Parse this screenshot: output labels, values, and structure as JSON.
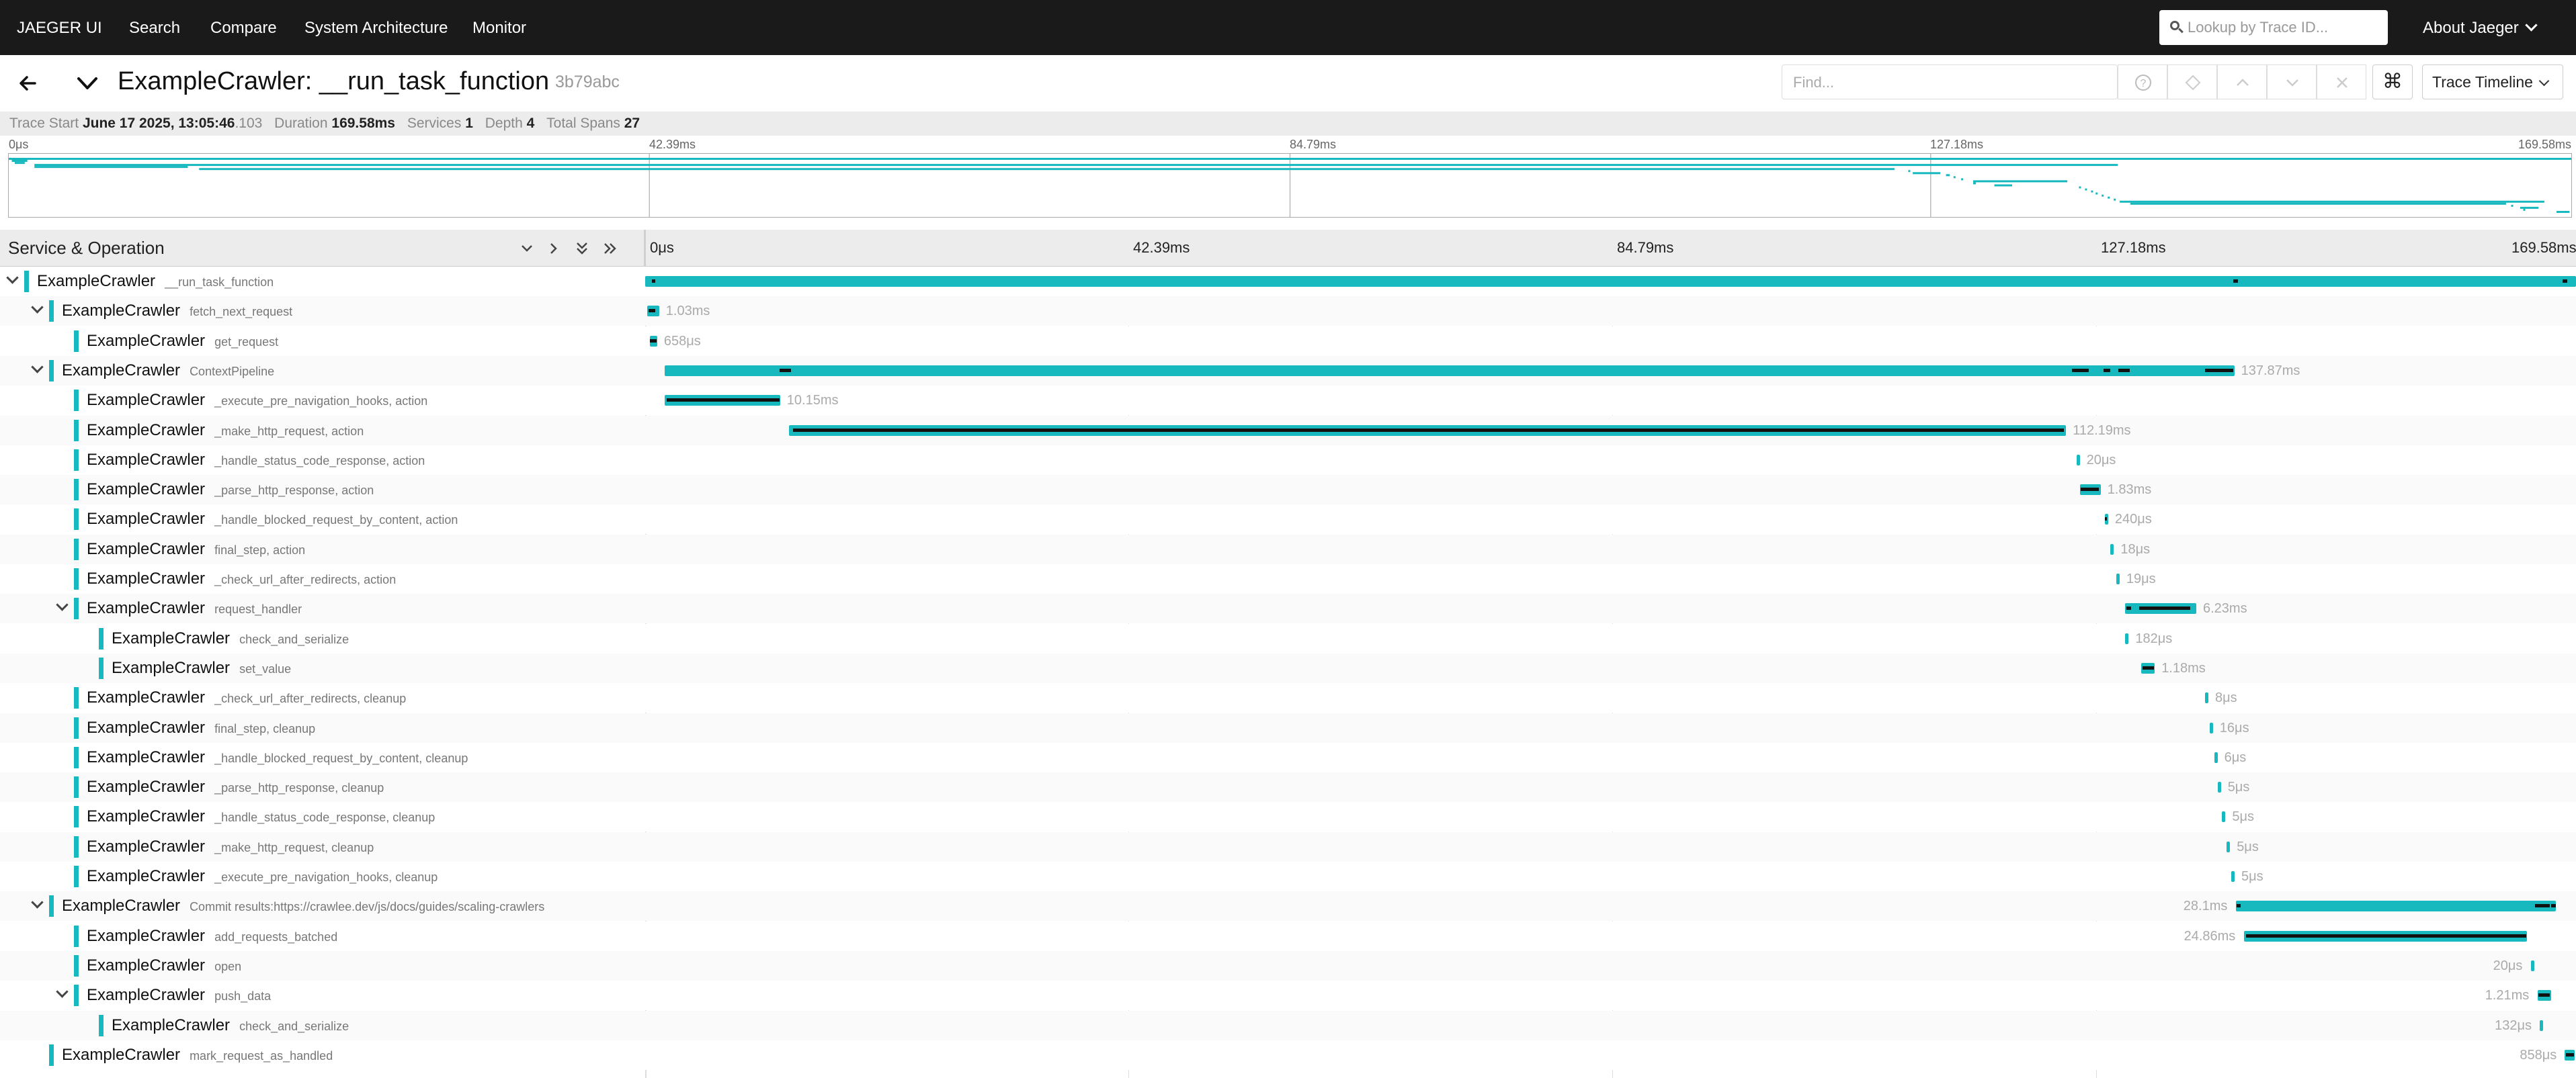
{
  "nav": {
    "brand": "JAEGER UI",
    "search": "Search",
    "compare": "Compare",
    "system_architecture": "System Architecture",
    "monitor": "Monitor",
    "lookup_placeholder": "Lookup by Trace ID...",
    "about": "About Jaeger"
  },
  "header": {
    "title": "ExampleCrawler: __run_task_function",
    "trace_id": "3b79abc",
    "find_placeholder": "Find...",
    "kbd_icon": "⌘",
    "view_select": "Trace Timeline"
  },
  "stats": {
    "trace_start_label": "Trace Start",
    "trace_start_value": "June 17 2025, 13:05:46",
    "trace_start_ms": ".103",
    "duration_label": "Duration",
    "duration_value": "169.58ms",
    "services_label": "Services",
    "services_value": "1",
    "depth_label": "Depth",
    "depth_value": "4",
    "total_spans_label": "Total Spans",
    "total_spans_value": "27"
  },
  "ticks": [
    "0μs",
    "42.39ms",
    "84.79ms",
    "127.18ms",
    "169.58ms"
  ],
  "timeline_header": {
    "title": "Service & Operation"
  },
  "accent": "#17b8be",
  "total_ms": 169.58,
  "spans": [
    {
      "service": "ExampleCrawler",
      "op": "__run_task_function",
      "depth": 0,
      "collapsible": true,
      "start": 0,
      "dur": 169.58,
      "dur_label": "",
      "crit": [
        [
          0.6,
          0.3
        ],
        [
          139.5,
          0.4
        ],
        [
          168.4,
          0.4
        ]
      ]
    },
    {
      "service": "ExampleCrawler",
      "op": "fetch_next_request",
      "depth": 1,
      "collapsible": true,
      "start": 0.2,
      "dur": 1.03,
      "dur_label": "1.03ms",
      "crit": [
        [
          0.3,
          0.6
        ]
      ]
    },
    {
      "service": "ExampleCrawler",
      "op": "get_request",
      "depth": 2,
      "collapsible": false,
      "start": 0.4,
      "dur": 0.658,
      "dur_label": "658μs",
      "crit": [
        [
          0.4,
          0.6
        ]
      ]
    },
    {
      "service": "ExampleCrawler",
      "op": "ContextPipeline",
      "depth": 1,
      "collapsible": true,
      "start": 1.7,
      "dur": 137.87,
      "dur_label": "137.87ms",
      "crit": [
        [
          11.8,
          1.0
        ],
        [
          125.3,
          1.5
        ],
        [
          128.1,
          0.6
        ],
        [
          129.4,
          1.0
        ],
        [
          137.0,
          2.5
        ]
      ]
    },
    {
      "service": "ExampleCrawler",
      "op": "_execute_pre_navigation_hooks, action",
      "depth": 2,
      "collapsible": false,
      "start": 1.7,
      "dur": 10.15,
      "dur_label": "10.15ms",
      "crit": [
        [
          1.9,
          9.9
        ]
      ]
    },
    {
      "service": "ExampleCrawler",
      "op": "_make_http_request, action",
      "depth": 2,
      "collapsible": false,
      "start": 12.6,
      "dur": 112.19,
      "dur_label": "112.19ms",
      "crit": [
        [
          13.0,
          111.6
        ]
      ]
    },
    {
      "service": "ExampleCrawler",
      "op": "_handle_status_code_response, action",
      "depth": 2,
      "collapsible": false,
      "start": 125.7,
      "dur": 0.02,
      "dur_label": "20μs",
      "crit": []
    },
    {
      "service": "ExampleCrawler",
      "op": "_parse_http_response, action",
      "depth": 2,
      "collapsible": false,
      "start": 126.0,
      "dur": 1.83,
      "dur_label": "1.83ms",
      "crit": [
        [
          126.1,
          1.6
        ]
      ]
    },
    {
      "service": "ExampleCrawler",
      "op": "_handle_blocked_request_by_content, action",
      "depth": 2,
      "collapsible": false,
      "start": 128.2,
      "dur": 0.24,
      "dur_label": "240μs",
      "crit": [
        [
          128.2,
          0.2
        ]
      ]
    },
    {
      "service": "ExampleCrawler",
      "op": "final_step, action",
      "depth": 2,
      "collapsible": false,
      "start": 128.7,
      "dur": 0.018,
      "dur_label": "18μs",
      "crit": []
    },
    {
      "service": "ExampleCrawler",
      "op": "_check_url_after_redirects, action",
      "depth": 2,
      "collapsible": false,
      "start": 129.2,
      "dur": 0.019,
      "dur_label": "19μs",
      "crit": []
    },
    {
      "service": "ExampleCrawler",
      "op": "request_handler",
      "depth": 2,
      "collapsible": true,
      "start": 130.0,
      "dur": 6.23,
      "dur_label": "6.23ms",
      "crit": [
        [
          130.1,
          0.4
        ],
        [
          131.2,
          4.5
        ]
      ]
    },
    {
      "service": "ExampleCrawler",
      "op": "check_and_serialize",
      "depth": 3,
      "collapsible": false,
      "start": 130.0,
      "dur": 0.182,
      "dur_label": "182μs",
      "crit": []
    },
    {
      "service": "ExampleCrawler",
      "op": "set_value",
      "depth": 3,
      "collapsible": false,
      "start": 131.4,
      "dur": 1.18,
      "dur_label": "1.18ms",
      "crit": [
        [
          131.5,
          1.0
        ]
      ]
    },
    {
      "service": "ExampleCrawler",
      "op": "_check_url_after_redirects, cleanup",
      "depth": 2,
      "collapsible": false,
      "start": 137.0,
      "dur": 0.008,
      "dur_label": "8μs",
      "crit": []
    },
    {
      "service": "ExampleCrawler",
      "op": "final_step, cleanup",
      "depth": 2,
      "collapsible": false,
      "start": 137.4,
      "dur": 0.016,
      "dur_label": "16μs",
      "crit": []
    },
    {
      "service": "ExampleCrawler",
      "op": "_handle_blocked_request_by_content, cleanup",
      "depth": 2,
      "collapsible": false,
      "start": 137.8,
      "dur": 0.006,
      "dur_label": "6μs",
      "crit": []
    },
    {
      "service": "ExampleCrawler",
      "op": "_parse_http_response, cleanup",
      "depth": 2,
      "collapsible": false,
      "start": 138.1,
      "dur": 0.005,
      "dur_label": "5μs",
      "crit": []
    },
    {
      "service": "ExampleCrawler",
      "op": "_handle_status_code_response, cleanup",
      "depth": 2,
      "collapsible": false,
      "start": 138.5,
      "dur": 0.005,
      "dur_label": "5μs",
      "crit": []
    },
    {
      "service": "ExampleCrawler",
      "op": "_make_http_request, cleanup",
      "depth": 2,
      "collapsible": false,
      "start": 138.9,
      "dur": 0.005,
      "dur_label": "5μs",
      "crit": []
    },
    {
      "service": "ExampleCrawler",
      "op": "_execute_pre_navigation_hooks, cleanup",
      "depth": 2,
      "collapsible": false,
      "start": 139.3,
      "dur": 0.005,
      "dur_label": "5μs",
      "crit": []
    },
    {
      "service": "ExampleCrawler",
      "op": "Commit results:https://crawlee.dev/js/docs/guides/scaling-crawlers",
      "depth": 1,
      "collapsible": true,
      "start": 139.7,
      "dur": 28.1,
      "dur_label": "28.1ms",
      "crit": [
        [
          139.8,
          0.3
        ],
        [
          166.0,
          1.3
        ],
        [
          167.4,
          0.4
        ]
      ]
    },
    {
      "service": "ExampleCrawler",
      "op": "add_requests_batched",
      "depth": 2,
      "collapsible": false,
      "start": 140.4,
      "dur": 24.86,
      "dur_label": "24.86ms",
      "crit": [
        [
          140.6,
          24.6
        ]
      ]
    },
    {
      "service": "ExampleCrawler",
      "op": "open",
      "depth": 2,
      "collapsible": false,
      "start": 165.6,
      "dur": 0.02,
      "dur_label": "20μs",
      "crit": []
    },
    {
      "service": "ExampleCrawler",
      "op": "push_data",
      "depth": 2,
      "collapsible": true,
      "start": 166.2,
      "dur": 1.21,
      "dur_label": "1.21ms",
      "crit": [
        [
          166.3,
          1.0
        ]
      ]
    },
    {
      "service": "ExampleCrawler",
      "op": "check_and_serialize",
      "depth": 3,
      "collapsible": false,
      "start": 166.4,
      "dur": 0.132,
      "dur_label": "132μs",
      "crit": []
    },
    {
      "service": "ExampleCrawler",
      "op": "mark_request_as_handled",
      "depth": 1,
      "collapsible": false,
      "start": 168.6,
      "dur": 0.858,
      "dur_label": "858μs",
      "crit": [
        [
          168.7,
          0.7
        ]
      ]
    }
  ]
}
